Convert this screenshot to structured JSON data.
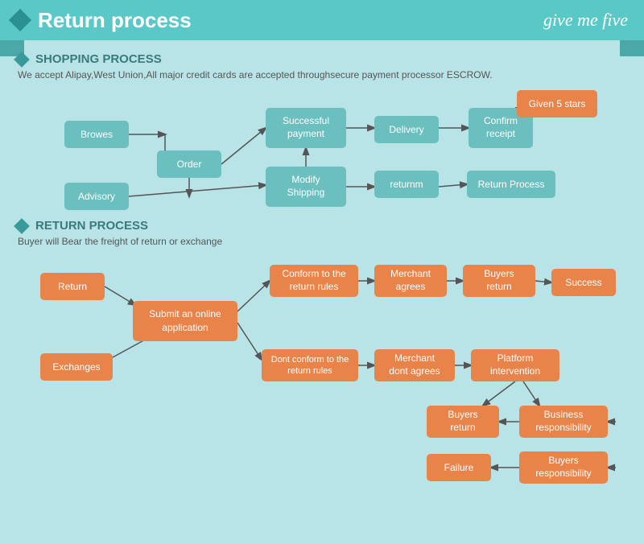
{
  "header": {
    "title": "Return process",
    "logo": "give me five"
  },
  "shopping": {
    "section_title": "SHOPPING PROCESS",
    "desc": "We accept Alipay,West Union,All major credit cards are accepted throughsecure payment processor ESCROW.",
    "boxes": {
      "browes": "Browes",
      "order": "Order",
      "advisory": "Advisory",
      "modify": "Modify\nShipping",
      "successful": "Successful\npayment",
      "returnm": "returnm",
      "delivery": "Delivery",
      "confirm": "Confirm\nreceipt",
      "given5": "Given 5 stars",
      "returnprocess": "Return Process"
    }
  },
  "return": {
    "section_title": "RETURN PROCESS",
    "desc": "Buyer will Bear the freight of return or exchange",
    "boxes": {
      "return": "Return",
      "submit": "Submit an online\napplication",
      "exchanges": "Exchanges",
      "conform": "Conform to the\nreturn rules",
      "merchant_agrees": "Merchant\nagrees",
      "buyers_return1": "Buyers\nreturn",
      "success": "Success",
      "dont_conform": "Dont conform to the\nreturn rules",
      "merchant_dont": "Merchant\ndont agrees",
      "platform": "Platform\nintervention",
      "buyers_return2": "Buyers\nreturn",
      "business_resp": "Business\nresponsibility",
      "failure": "Failure",
      "buyers_resp": "Buyers\nresponsibility"
    }
  }
}
